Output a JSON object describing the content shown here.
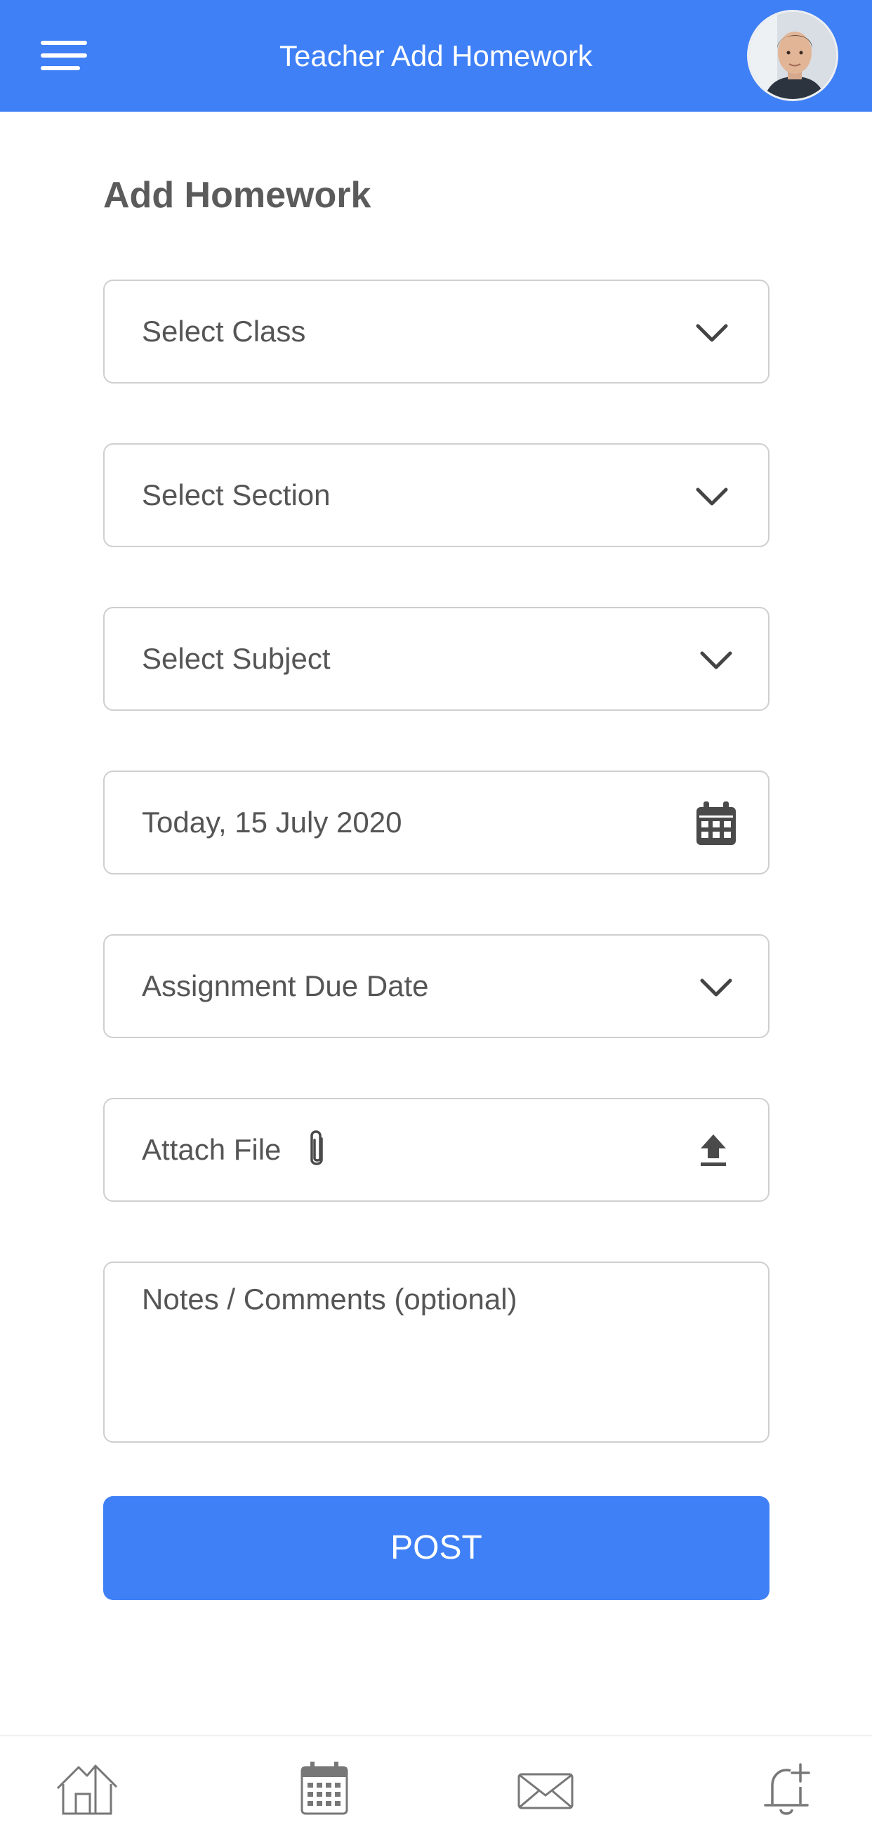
{
  "header": {
    "title": "Teacher Add Homework",
    "background": "#3f80f7"
  },
  "page": {
    "title": "Add Homework"
  },
  "form": {
    "class_select": {
      "placeholder": "Select Class",
      "icon": "chevron-down-icon"
    },
    "section_select": {
      "placeholder": "Select Section",
      "icon": "chevron-down-icon"
    },
    "subject_select": {
      "placeholder": "Select Subject",
      "icon": "chevron-down-icon"
    },
    "date_field": {
      "value": "Today, 15 July 2020",
      "icon": "calendar-icon"
    },
    "due_date_select": {
      "placeholder": "Assignment Due Date",
      "icon": "chevron-down-icon"
    },
    "attach_file": {
      "label": "Attach File",
      "icons": [
        "paperclip-icon",
        "upload-icon"
      ]
    },
    "notes": {
      "placeholder": "Notes / Comments (optional)"
    },
    "post_button": {
      "label": "POST",
      "color": "#3f80f7"
    }
  },
  "bottom_nav": {
    "items": [
      {
        "icon": "home-icon"
      },
      {
        "icon": "calendar-icon"
      },
      {
        "icon": "mail-icon"
      },
      {
        "icon": "bell-add-icon"
      }
    ]
  }
}
